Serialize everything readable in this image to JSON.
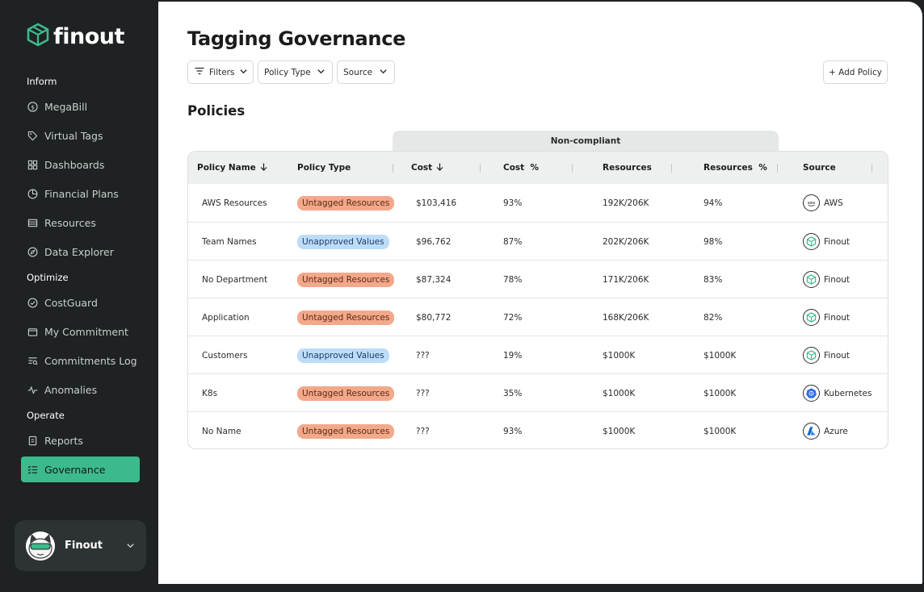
{
  "app": {
    "logo_text": "finout",
    "accent_color": "#3dba8c"
  },
  "sidebar": {
    "sections": [
      {
        "label": "Inform"
      },
      {
        "label": "Optimize"
      },
      {
        "label": "Operate"
      }
    ],
    "items": [
      {
        "label": "MegaBill",
        "icon": "dollar-circle-icon"
      },
      {
        "label": "Virtual Tags",
        "icon": "tag-icon"
      },
      {
        "label": "Dashboards",
        "icon": "grid-icon"
      },
      {
        "label": "Financial Plans",
        "icon": "pie-chart-icon"
      },
      {
        "label": "Resources",
        "icon": "list-box-icon"
      },
      {
        "label": "Data Explorer",
        "icon": "compass-icon"
      },
      {
        "label": "CostGuard",
        "icon": "shield-check-icon"
      },
      {
        "label": "My Commitment",
        "icon": "folder-icon"
      },
      {
        "label": "Commitments Log",
        "icon": "log-icon"
      },
      {
        "label": "Anomalies",
        "icon": "pulse-icon"
      },
      {
        "label": "Reports",
        "icon": "document-icon"
      },
      {
        "label": "Governance",
        "icon": "checklist-icon",
        "active": true
      }
    ],
    "user": {
      "name": "Finout"
    }
  },
  "main": {
    "title": "Tagging Governance",
    "filters": [
      {
        "label": "Filters"
      },
      {
        "label": "Policy Type"
      },
      {
        "label": "Source"
      }
    ],
    "add_policy_label": "+ Add Policy",
    "section_title": "Policies",
    "group_header": "Non-compliant",
    "columns": [
      "Policy Name",
      "Policy Type",
      "Cost",
      "Cost  %",
      "Resources",
      "Resources  %",
      "Source"
    ],
    "rows": [
      {
        "name": "AWS Resources",
        "type": "Untagged Resources",
        "type_kind": "untagged",
        "cost": "$103,416",
        "cost_pct": "93%",
        "resources": "192K/206K",
        "resources_pct": "94%",
        "source": "AWS",
        "source_icon": "aws-icon"
      },
      {
        "name": "Team Names",
        "type": "Unapproved Values",
        "type_kind": "unapproved",
        "cost": "$96,762",
        "cost_pct": "87%",
        "resources": "202K/206K",
        "resources_pct": "98%",
        "source": "Finout",
        "source_icon": "finout-icon"
      },
      {
        "name": "No Department",
        "type": "Untagged Resources",
        "type_kind": "untagged",
        "cost": "$87,324",
        "cost_pct": "78%",
        "resources": "171K/206K",
        "resources_pct": "83%",
        "source": "Finout",
        "source_icon": "finout-icon"
      },
      {
        "name": "Application",
        "type": "Untagged Resources",
        "type_kind": "untagged",
        "cost": "$80,772",
        "cost_pct": "72%",
        "resources": "168K/206K",
        "resources_pct": "82%",
        "source": "Finout",
        "source_icon": "finout-icon"
      },
      {
        "name": "Customers",
        "type": "Unapproved Values",
        "type_kind": "unapproved",
        "cost": "???",
        "cost_pct": "19%",
        "resources": "$1000K",
        "resources_pct": "$1000K",
        "source": "Finout",
        "source_icon": "finout-icon"
      },
      {
        "name": "K8s",
        "type": "Untagged Resources",
        "type_kind": "untagged",
        "cost": "???",
        "cost_pct": "35%",
        "resources": "$1000K",
        "resources_pct": "$1000K",
        "source": "Kubernetes",
        "source_icon": "kubernetes-icon"
      },
      {
        "name": "No Name",
        "type": "Untagged Resources",
        "type_kind": "untagged",
        "cost": "???",
        "cost_pct": "93%",
        "resources": "$1000K",
        "resources_pct": "$1000K",
        "source": "Azure",
        "source_icon": "azure-icon"
      }
    ],
    "colors": {
      "untagged_bg": "#f3a88a",
      "untagged_text": "#5a2a16",
      "unapproved_bg": "#bcdcf8",
      "unapproved_text": "#1d3f66"
    }
  }
}
